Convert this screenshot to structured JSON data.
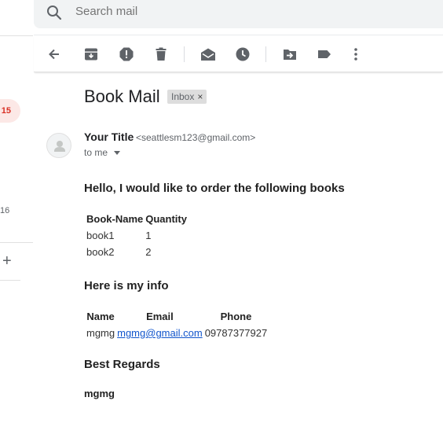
{
  "sidebar": {
    "count_highlighted": "15",
    "count_plain": "16",
    "add_label": "+"
  },
  "search": {
    "placeholder": "Search mail",
    "icon": "search-icon"
  },
  "toolbar": {
    "buttons": [
      "back-arrow-icon",
      "archive-icon",
      "report-spam-icon",
      "delete-icon",
      "mark-unread-icon",
      "snooze-icon",
      "move-to-icon",
      "label-icon",
      "more-icon"
    ]
  },
  "email": {
    "subject": "Book Mail",
    "label_chip": "Inbox",
    "label_chip_close": "×",
    "sender_name": "Your Title",
    "sender_email": "<seattlesm123@gmail.com>",
    "recipient": "to me",
    "greeting": "Hello, I would like to order the following books",
    "books_table": {
      "headers": [
        "Book-Name",
        "Quantity"
      ],
      "rows": [
        [
          "book1",
          "1"
        ],
        [
          "book2",
          "2"
        ]
      ]
    },
    "info_heading": "Here is my info",
    "info_table": {
      "headers": [
        "Name",
        "Email",
        "Phone"
      ],
      "rows": [
        [
          "mgmg",
          "mgmg@gmail.com",
          "09787377927"
        ]
      ]
    },
    "closing": "Best Regards",
    "signature": "mgmg"
  },
  "colors": {
    "count_badge_bg": "#fce8e6",
    "count_badge_text": "#d93025",
    "link": "#1155cc",
    "search_bg": "#f1f3f4"
  }
}
